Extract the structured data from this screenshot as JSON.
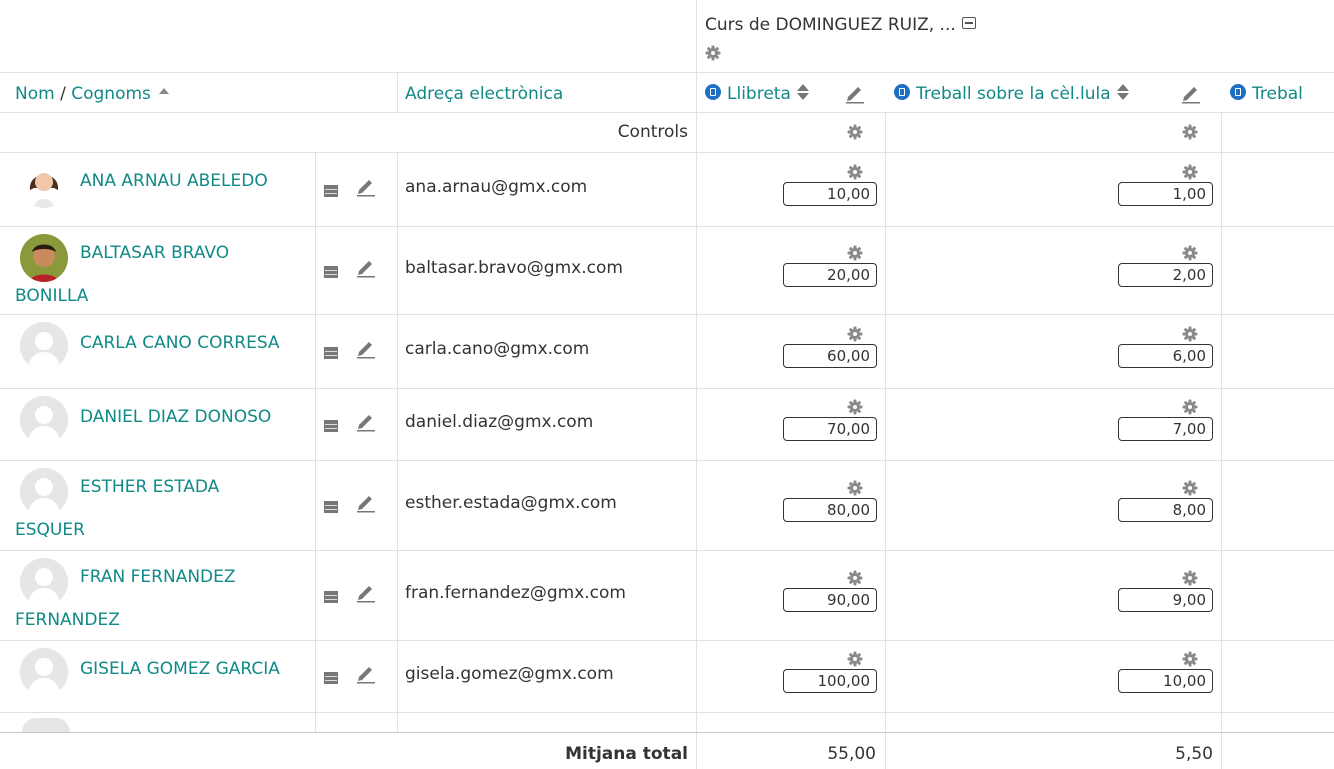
{
  "category": {
    "title": "Curs de DOMINGUEZ RUIZ, ..."
  },
  "headers": {
    "name_first": "Nom",
    "name_separator": " / ",
    "name_last": "Cognoms",
    "email": "Adreça electrònica",
    "items": [
      "Llibreta",
      "Treball sobre la cèl.lula",
      "Trebal"
    ]
  },
  "controls_label": "Controls",
  "students": [
    {
      "name_line1": "ANA ARNAU ABELEDO",
      "name_line2": "",
      "email": "ana.arnau@gmx.com",
      "grades": [
        "10,00",
        "1,00"
      ]
    },
    {
      "name_line1": "BALTASAR BRAVO",
      "name_line2": "BONILLA",
      "email": "baltasar.bravo@gmx.com",
      "grades": [
        "20,00",
        "2,00"
      ]
    },
    {
      "name_line1": "CARLA CANO CORRESA",
      "name_line2": "",
      "email": "carla.cano@gmx.com",
      "grades": [
        "60,00",
        "6,00"
      ]
    },
    {
      "name_line1": "DANIEL DIAZ DONOSO",
      "name_line2": "",
      "email": "daniel.diaz@gmx.com",
      "grades": [
        "70,00",
        "7,00"
      ]
    },
    {
      "name_line1": "ESTHER ESTADA",
      "name_line2": "ESQUER",
      "email": "esther.estada@gmx.com",
      "grades": [
        "80,00",
        "8,00"
      ]
    },
    {
      "name_line1": "FRAN FERNANDEZ",
      "name_line2": "FERNANDEZ",
      "email": "fran.fernandez@gmx.com",
      "grades": [
        "90,00",
        "9,00"
      ]
    },
    {
      "name_line1": "GISELA GOMEZ GARCIA",
      "name_line2": "",
      "email": "gisela.gomez@gmx.com",
      "grades": [
        "100,00",
        "10,00"
      ]
    }
  ],
  "footer": {
    "label": "Mitjana total",
    "averages": [
      "55,00",
      "5,50"
    ]
  },
  "colors": {
    "link": "#0f8a87",
    "module_icon": "#1f6fc5",
    "border": "#dee2e6"
  },
  "icons": [
    "gear-icon",
    "collapse-icon",
    "sort-asc-icon",
    "assignment-icon",
    "sort-updown-icon",
    "edit-pencil-icon",
    "single-view-icon"
  ]
}
